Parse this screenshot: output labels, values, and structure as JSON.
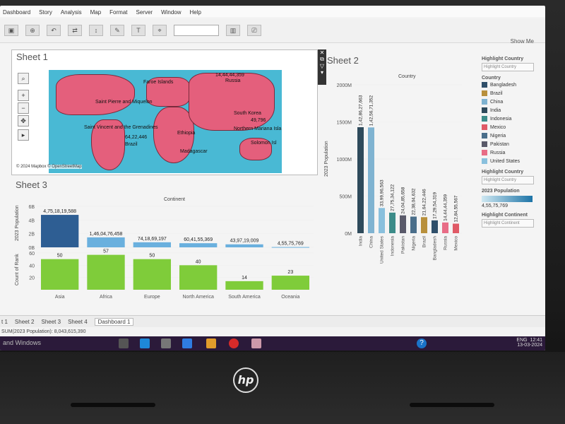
{
  "menu": [
    "Dashboard",
    "Story",
    "Analysis",
    "Map",
    "Format",
    "Server",
    "Window",
    "Help"
  ],
  "toolbar": {
    "show_me": "Show Me"
  },
  "sheet1": {
    "title": "Sheet 1",
    "attribution": "© 2024 Mapbox © OpenStreetMap",
    "labels": [
      "14,44,44,359",
      "Russia",
      "Faroe Islands",
      "Saint Pierre and Miquelon",
      "South Korea",
      "49,796",
      "Saint Vincent and the Grenadines",
      "Northern Mariana Isla",
      "Ethiopia",
      "Madagascar",
      "64,22,446",
      "Brazil",
      "Solomon Isl"
    ]
  },
  "sheet2": {
    "title": "Sheet 2",
    "header": "Country"
  },
  "sheet3": {
    "title": "Sheet 3",
    "header": "Continent"
  },
  "panel": {
    "highlight_country": "Highlight Country",
    "highlight_country_placeholder": "Highlight Country",
    "country": "Country",
    "countries": [
      {
        "name": "Bangladesh",
        "color": "#2f4f6a"
      },
      {
        "name": "Brazil",
        "color": "#b8903c"
      },
      {
        "name": "China",
        "color": "#7fb3d1"
      },
      {
        "name": "India",
        "color": "#2e4a5b"
      },
      {
        "name": "Indonesia",
        "color": "#3c8c89"
      },
      {
        "name": "Mexico",
        "color": "#e05a66"
      },
      {
        "name": "Nigeria",
        "color": "#4a6e8a"
      },
      {
        "name": "Pakistan",
        "color": "#5a5a6a"
      },
      {
        "name": "Russia",
        "color": "#e86c86"
      },
      {
        "name": "United States",
        "color": "#89c0dd"
      }
    ],
    "highlight_country2": "Highlight Country",
    "population_2023": "2023 Population",
    "population_value": "4,55,75,769",
    "highlight_continent": "Highlight Continent",
    "highlight_continent_placeholder": "Highlight Continent"
  },
  "tabs": [
    "t 1",
    "Sheet 2",
    "Sheet 3",
    "Sheet 4",
    "Dashboard 1"
  ],
  "status": "SUM(2023 Population): 8,043,615,390",
  "taskbar": {
    "left_text": "and Windows",
    "lang": "ENG",
    "time": "12:41",
    "date": "13-03-2024"
  },
  "chart_data": [
    {
      "type": "bar",
      "title": "Country",
      "ylabel": "2023 Population",
      "ylim": [
        0,
        2000
      ],
      "yticks": [
        "0M",
        "500M",
        "1000M",
        "1500M",
        "2000M"
      ],
      "categories": [
        "India",
        "China",
        "United States",
        "Indonesia",
        "Pakistan",
        "Nigeria",
        "Brazil",
        "Bangladesh",
        "Russia",
        "Mexico"
      ],
      "values": [
        1428.6,
        1425.7,
        340.0,
        277.5,
        240.5,
        223.8,
        216.4,
        172.9,
        144.4,
        128.5
      ],
      "value_labels": [
        "1,42,86,27,663",
        "1,42,56,71,352",
        "33,99,96,563",
        "27,75,34,122",
        "24,04,85,658",
        "22,38,04,632",
        "21,64,22,446",
        "17,29,54,319",
        "14,44,44,359",
        "12,84,55,567"
      ],
      "colors": [
        "#2e4a5b",
        "#7fb3d1",
        "#89c0dd",
        "#3c8c89",
        "#5a5a6a",
        "#4a6e8a",
        "#b8903c",
        "#2f4f6a",
        "#e86c86",
        "#e05a66"
      ]
    },
    {
      "type": "bar",
      "title": "Continent",
      "categories": [
        "Asia",
        "Africa",
        "Europe",
        "North America",
        "South America",
        "Oceania"
      ],
      "series": [
        {
          "name": "2023 Population",
          "values": [
            4751.8,
            1460.5,
            741.8,
            604.2,
            439.7,
            45.6
          ],
          "labels": [
            "4,75,18,19,588",
            "1,46,04,76,458",
            "74,18,69,197",
            "60,41,55,369",
            "43,97,19,009",
            "4,55,75,769"
          ],
          "ylim": [
            0,
            6
          ],
          "yticks": [
            "0B",
            "2B",
            "4B",
            "6B"
          ]
        },
        {
          "name": "Count of Rank",
          "values": [
            50,
            57,
            50,
            40,
            14,
            23
          ],
          "labels": [
            "50",
            "57",
            "50",
            "40",
            "14",
            "23"
          ],
          "ylim": [
            0,
            60
          ],
          "yticks": [
            "20",
            "40",
            "60"
          ]
        }
      ]
    }
  ]
}
